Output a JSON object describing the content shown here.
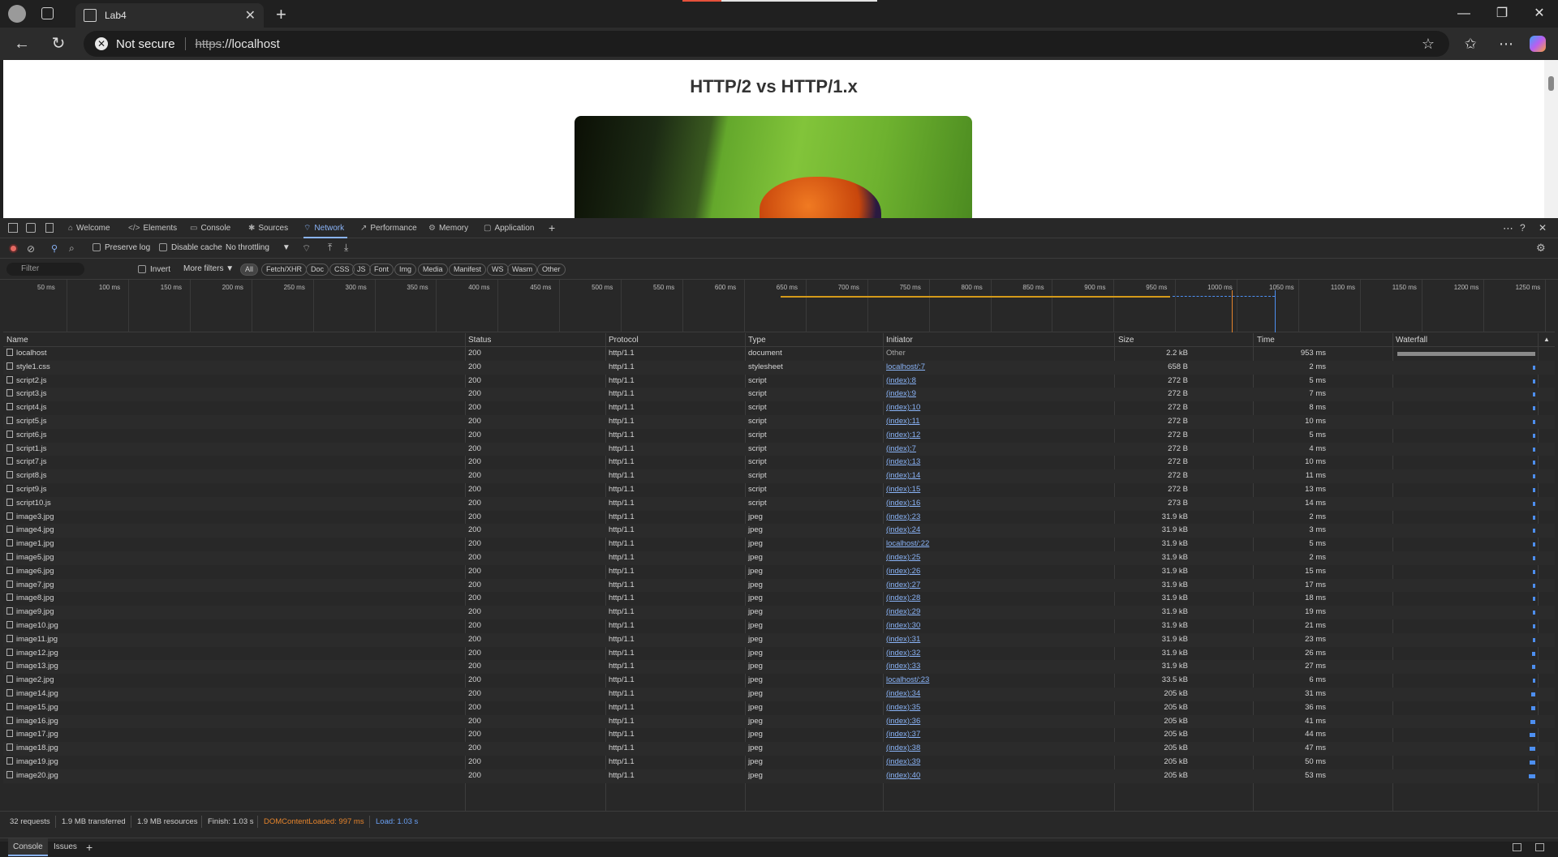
{
  "browser": {
    "tab_title": "Lab4",
    "security_label": "Not secure",
    "url_scheme": "https",
    "url_rest": "://localhost"
  },
  "page": {
    "heading": "HTTP/2 vs HTTP/1.x"
  },
  "devtools": {
    "tabs": [
      {
        "label": "Welcome",
        "icon": "home-icon"
      },
      {
        "label": "Elements",
        "icon": "code-icon"
      },
      {
        "label": "Console",
        "icon": "console-icon"
      },
      {
        "label": "Sources",
        "icon": "bug-icon"
      },
      {
        "label": "Network",
        "icon": "wifi-icon",
        "active": true
      },
      {
        "label": "Performance",
        "icon": "performance-icon"
      },
      {
        "label": "Memory",
        "icon": "memory-icon"
      },
      {
        "label": "Application",
        "icon": "application-icon"
      }
    ],
    "toolbar": {
      "preserve_log": "Preserve log",
      "disable_cache": "Disable cache",
      "throttling": "No throttling"
    },
    "filter": {
      "placeholder": "Filter",
      "invert": "Invert",
      "more_filters": "More filters",
      "chips": [
        "All",
        "Fetch/XHR",
        "Doc",
        "CSS",
        "JS",
        "Font",
        "Img",
        "Media",
        "Manifest",
        "WS",
        "Wasm",
        "Other"
      ]
    },
    "overview_ticks": [
      "50 ms",
      "100 ms",
      "150 ms",
      "200 ms",
      "250 ms",
      "300 ms",
      "350 ms",
      "400 ms",
      "450 ms",
      "500 ms",
      "550 ms",
      "600 ms",
      "650 ms",
      "700 ms",
      "750 ms",
      "800 ms",
      "850 ms",
      "900 ms",
      "950 ms",
      "1000 ms",
      "1050 ms",
      "1100 ms",
      "1150 ms",
      "1200 ms",
      "1250 ms"
    ],
    "columns": {
      "name": "Name",
      "status": "Status",
      "protocol": "Protocol",
      "type": "Type",
      "initiator": "Initiator",
      "size": "Size",
      "time": "Time",
      "waterfall": "Waterfall"
    },
    "requests": [
      {
        "name": "localhost",
        "status": "200",
        "protocol": "http/1.1",
        "type": "document",
        "initiator": "Other",
        "size": "2.2 kB",
        "time": "953 ms",
        "time_ms": 953
      },
      {
        "name": "style1.css",
        "status": "200",
        "protocol": "http/1.1",
        "type": "stylesheet",
        "initiator": "localhost/:7",
        "size": "658 B",
        "time": "2 ms",
        "time_ms": 2
      },
      {
        "name": "script2.js",
        "status": "200",
        "protocol": "http/1.1",
        "type": "script",
        "initiator": "(index):8",
        "size": "272 B",
        "time": "5 ms",
        "time_ms": 5
      },
      {
        "name": "script3.js",
        "status": "200",
        "protocol": "http/1.1",
        "type": "script",
        "initiator": "(index):9",
        "size": "272 B",
        "time": "7 ms",
        "time_ms": 7
      },
      {
        "name": "script4.js",
        "status": "200",
        "protocol": "http/1.1",
        "type": "script",
        "initiator": "(index):10",
        "size": "272 B",
        "time": "8 ms",
        "time_ms": 8
      },
      {
        "name": "script5.js",
        "status": "200",
        "protocol": "http/1.1",
        "type": "script",
        "initiator": "(index):11",
        "size": "272 B",
        "time": "10 ms",
        "time_ms": 10
      },
      {
        "name": "script6.js",
        "status": "200",
        "protocol": "http/1.1",
        "type": "script",
        "initiator": "(index):12",
        "size": "272 B",
        "time": "5 ms",
        "time_ms": 5
      },
      {
        "name": "script1.js",
        "status": "200",
        "protocol": "http/1.1",
        "type": "script",
        "initiator": "(index):7",
        "size": "272 B",
        "time": "4 ms",
        "time_ms": 4
      },
      {
        "name": "script7.js",
        "status": "200",
        "protocol": "http/1.1",
        "type": "script",
        "initiator": "(index):13",
        "size": "272 B",
        "time": "10 ms",
        "time_ms": 10
      },
      {
        "name": "script8.js",
        "status": "200",
        "protocol": "http/1.1",
        "type": "script",
        "initiator": "(index):14",
        "size": "272 B",
        "time": "11 ms",
        "time_ms": 11
      },
      {
        "name": "script9.js",
        "status": "200",
        "protocol": "http/1.1",
        "type": "script",
        "initiator": "(index):15",
        "size": "272 B",
        "time": "13 ms",
        "time_ms": 13
      },
      {
        "name": "script10.js",
        "status": "200",
        "protocol": "http/1.1",
        "type": "script",
        "initiator": "(index):16",
        "size": "273 B",
        "time": "14 ms",
        "time_ms": 14
      },
      {
        "name": "image3.jpg",
        "status": "200",
        "protocol": "http/1.1",
        "type": "jpeg",
        "initiator": "(index):23",
        "size": "31.9 kB",
        "time": "2 ms",
        "time_ms": 2
      },
      {
        "name": "image4.jpg",
        "status": "200",
        "protocol": "http/1.1",
        "type": "jpeg",
        "initiator": "(index):24",
        "size": "31.9 kB",
        "time": "3 ms",
        "time_ms": 3
      },
      {
        "name": "image1.jpg",
        "status": "200",
        "protocol": "http/1.1",
        "type": "jpeg",
        "initiator": "localhost/:22",
        "size": "31.9 kB",
        "time": "5 ms",
        "time_ms": 5
      },
      {
        "name": "image5.jpg",
        "status": "200",
        "protocol": "http/1.1",
        "type": "jpeg",
        "initiator": "(index):25",
        "size": "31.9 kB",
        "time": "2 ms",
        "time_ms": 2
      },
      {
        "name": "image6.jpg",
        "status": "200",
        "protocol": "http/1.1",
        "type": "jpeg",
        "initiator": "(index):26",
        "size": "31.9 kB",
        "time": "15 ms",
        "time_ms": 15
      },
      {
        "name": "image7.jpg",
        "status": "200",
        "protocol": "http/1.1",
        "type": "jpeg",
        "initiator": "(index):27",
        "size": "31.9 kB",
        "time": "17 ms",
        "time_ms": 17
      },
      {
        "name": "image8.jpg",
        "status": "200",
        "protocol": "http/1.1",
        "type": "jpeg",
        "initiator": "(index):28",
        "size": "31.9 kB",
        "time": "18 ms",
        "time_ms": 18
      },
      {
        "name": "image9.jpg",
        "status": "200",
        "protocol": "http/1.1",
        "type": "jpeg",
        "initiator": "(index):29",
        "size": "31.9 kB",
        "time": "19 ms",
        "time_ms": 19
      },
      {
        "name": "image10.jpg",
        "status": "200",
        "protocol": "http/1.1",
        "type": "jpeg",
        "initiator": "(index):30",
        "size": "31.9 kB",
        "time": "21 ms",
        "time_ms": 21
      },
      {
        "name": "image11.jpg",
        "status": "200",
        "protocol": "http/1.1",
        "type": "jpeg",
        "initiator": "(index):31",
        "size": "31.9 kB",
        "time": "23 ms",
        "time_ms": 23
      },
      {
        "name": "image12.jpg",
        "status": "200",
        "protocol": "http/1.1",
        "type": "jpeg",
        "initiator": "(index):32",
        "size": "31.9 kB",
        "time": "26 ms",
        "time_ms": 26
      },
      {
        "name": "image13.jpg",
        "status": "200",
        "protocol": "http/1.1",
        "type": "jpeg",
        "initiator": "(index):33",
        "size": "31.9 kB",
        "time": "27 ms",
        "time_ms": 27
      },
      {
        "name": "image2.jpg",
        "status": "200",
        "protocol": "http/1.1",
        "type": "jpeg",
        "initiator": "localhost/:23",
        "size": "33.5 kB",
        "time": "6 ms",
        "time_ms": 6
      },
      {
        "name": "image14.jpg",
        "status": "200",
        "protocol": "http/1.1",
        "type": "jpeg",
        "initiator": "(index):34",
        "size": "205 kB",
        "time": "31 ms",
        "time_ms": 31
      },
      {
        "name": "image15.jpg",
        "status": "200",
        "protocol": "http/1.1",
        "type": "jpeg",
        "initiator": "(index):35",
        "size": "205 kB",
        "time": "36 ms",
        "time_ms": 36
      },
      {
        "name": "image16.jpg",
        "status": "200",
        "protocol": "http/1.1",
        "type": "jpeg",
        "initiator": "(index):36",
        "size": "205 kB",
        "time": "41 ms",
        "time_ms": 41
      },
      {
        "name": "image17.jpg",
        "status": "200",
        "protocol": "http/1.1",
        "type": "jpeg",
        "initiator": "(index):37",
        "size": "205 kB",
        "time": "44 ms",
        "time_ms": 44
      },
      {
        "name": "image18.jpg",
        "status": "200",
        "protocol": "http/1.1",
        "type": "jpeg",
        "initiator": "(index):38",
        "size": "205 kB",
        "time": "47 ms",
        "time_ms": 47
      },
      {
        "name": "image19.jpg",
        "status": "200",
        "protocol": "http/1.1",
        "type": "jpeg",
        "initiator": "(index):39",
        "size": "205 kB",
        "time": "50 ms",
        "time_ms": 50
      },
      {
        "name": "image20.jpg",
        "status": "200",
        "protocol": "http/1.1",
        "type": "jpeg",
        "initiator": "(index):40",
        "size": "205 kB",
        "time": "53 ms",
        "time_ms": 53
      }
    ],
    "summary": {
      "requests": "32 requests",
      "transferred": "1.9 MB transferred",
      "resources": "1.9 MB resources",
      "finish": "Finish: 1.03 s",
      "dom_content_loaded": "DOMContentLoaded: 997 ms",
      "load": "Load: 1.03 s"
    },
    "drawer": {
      "console_tab": "Console",
      "issues_tab": "Issues"
    },
    "colors": {
      "accent": "#8ab4f8",
      "dcl": "#e5842c",
      "load": "#4d8ff0"
    }
  }
}
